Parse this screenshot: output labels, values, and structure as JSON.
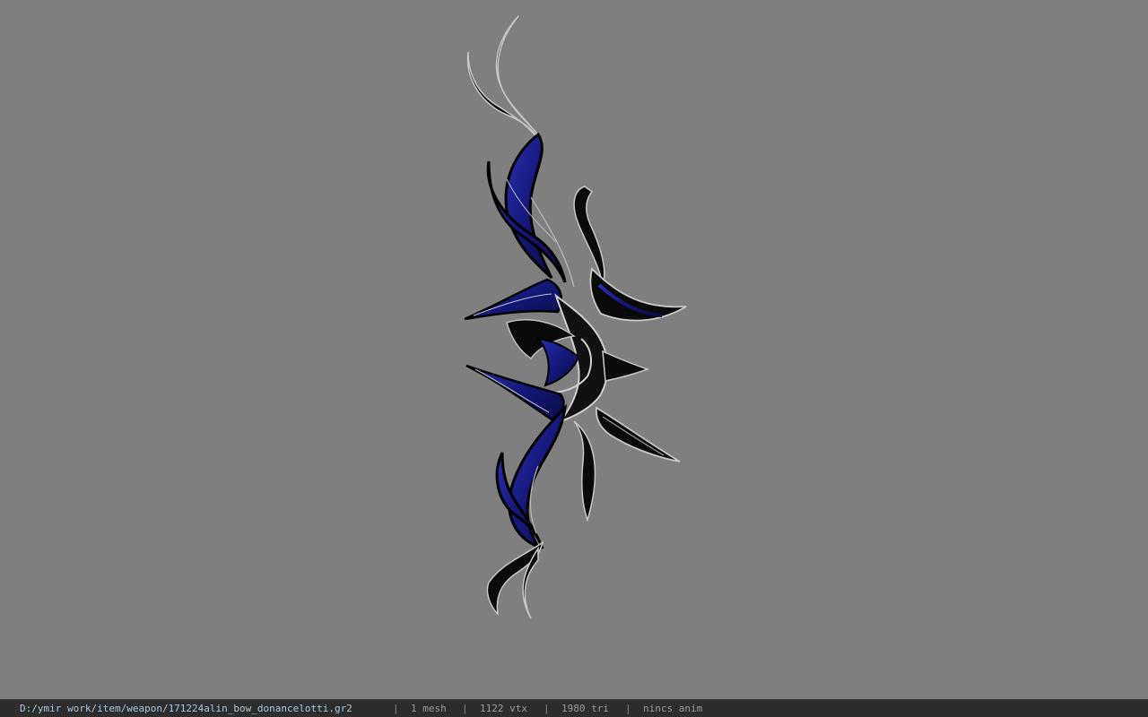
{
  "viewer": {
    "background_color": "#7f7f7f",
    "model": {
      "name": "alin bow",
      "primary_color": "#1a1f8c",
      "outline_color": "#000000",
      "highlight_color": "#b8b8c8"
    }
  },
  "status_bar": {
    "file_path": "D:/ymir work/item/weapon/171224alin_bow_donancelotti.gr2",
    "separator": "|",
    "mesh_count": "1 mesh",
    "vertex_count": "1122 vtx",
    "triangle_count": "1980 tri",
    "anim_status": "nincs anim"
  }
}
